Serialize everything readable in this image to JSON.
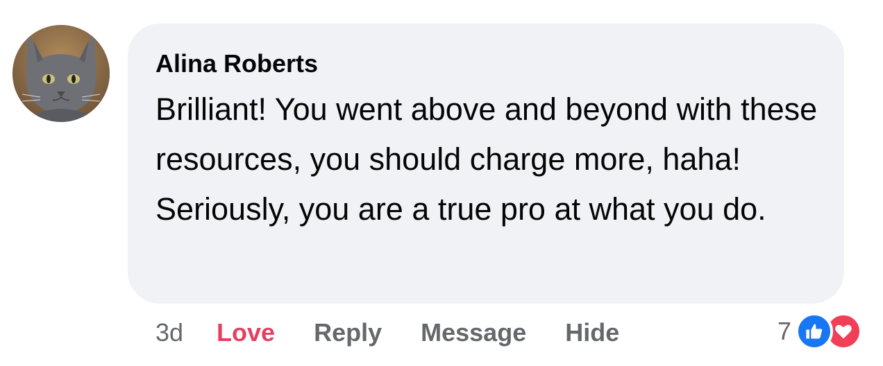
{
  "comment": {
    "author": "Alina Roberts",
    "text": "Brilliant! You went above and beyond with these resources, you should charge more, haha! Seriously, you are a true pro at what you do.",
    "avatar_icon": "cat-avatar"
  },
  "actions": {
    "time": "3d",
    "love_label": "Love",
    "reply_label": "Reply",
    "message_label": "Message",
    "hide_label": "Hide"
  },
  "reactions": {
    "count": "7",
    "icons": [
      "like-icon",
      "heart-icon"
    ]
  },
  "colors": {
    "bubble_bg": "#f0f2f5",
    "love_active": "#e4405f",
    "like_blue": "#1877f2",
    "heart_red": "#f33e58",
    "muted_text": "#65676b"
  }
}
